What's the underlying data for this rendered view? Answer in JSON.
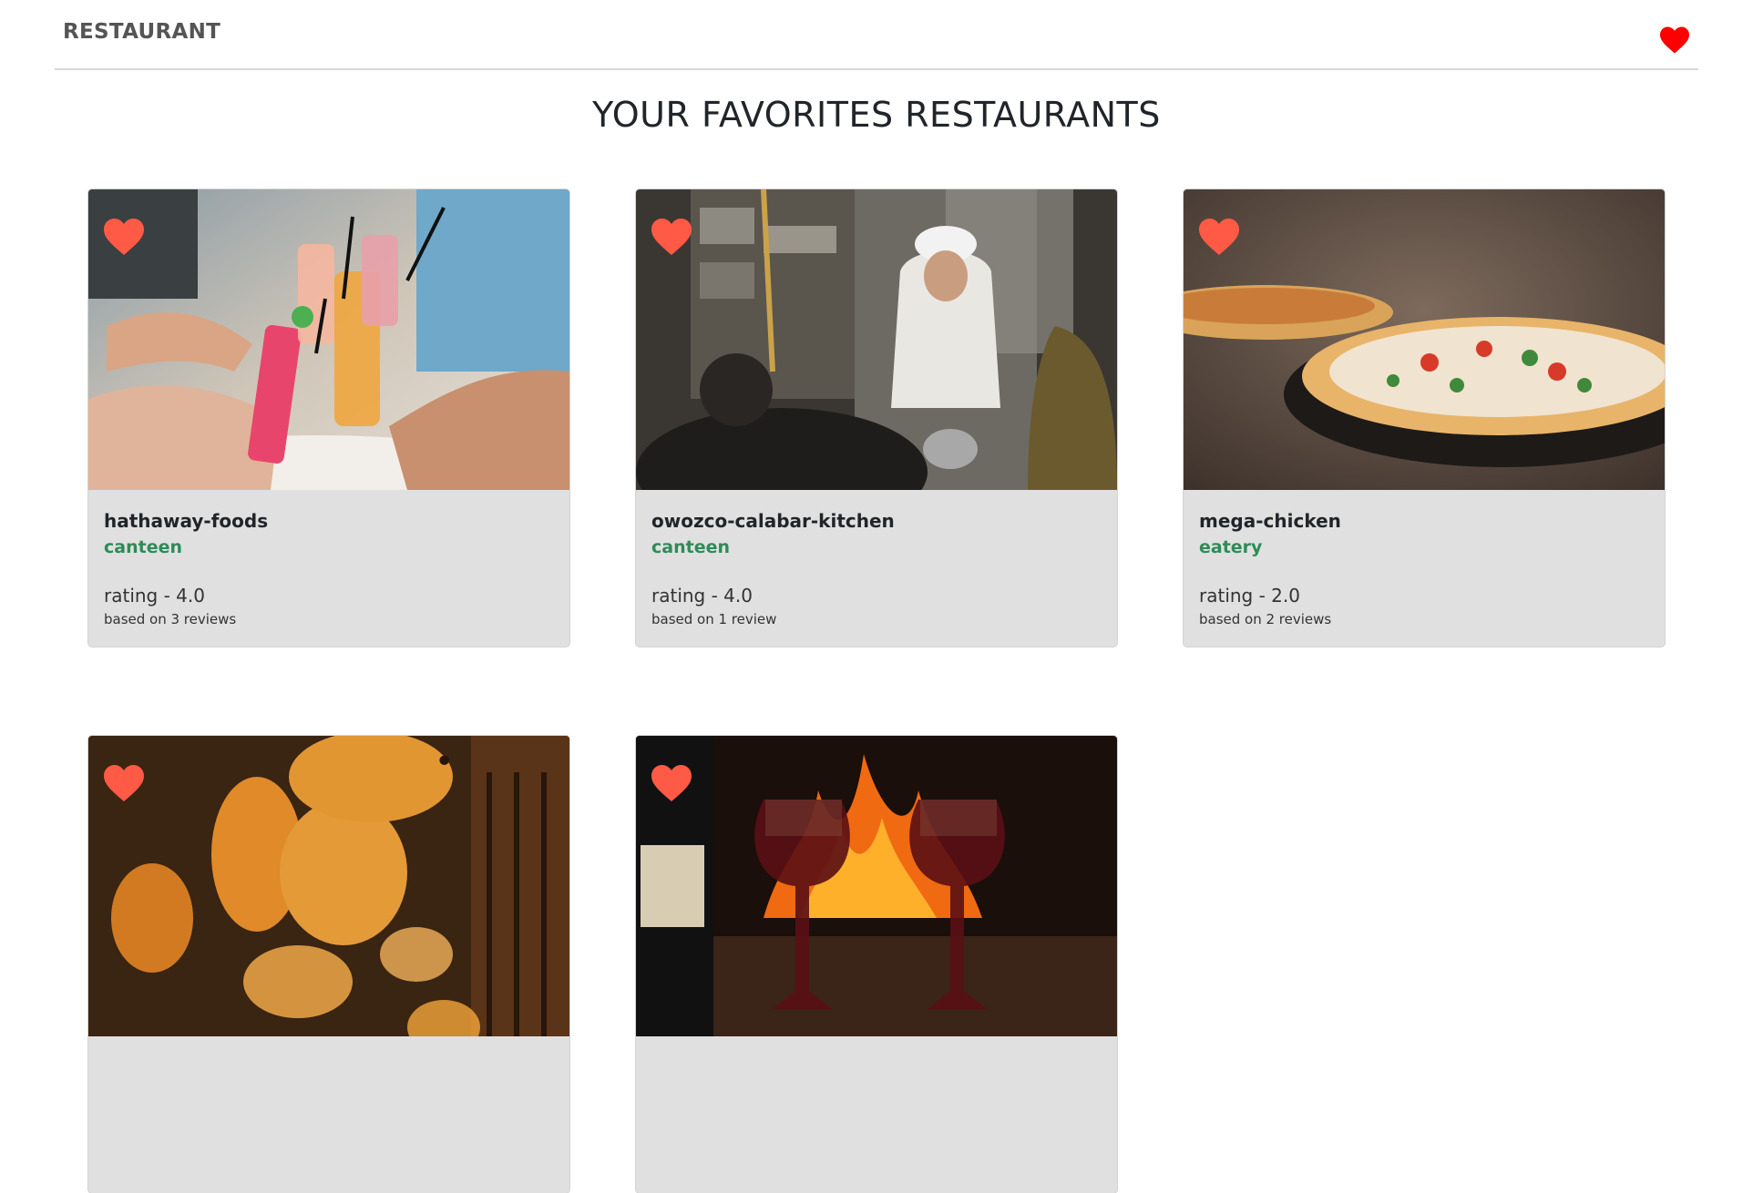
{
  "navbar": {
    "brand": "RESTAURANT",
    "favorites_icon": "heart-icon",
    "heart_color": "#ff0000"
  },
  "page": {
    "title": "YOUR FAVORITES RESTAURANTS"
  },
  "colors": {
    "type_text": "#2e8b57",
    "card_heart": "#ff5a45",
    "card_bg": "#e0e0e0"
  },
  "restaurants": [
    {
      "name": "hathaway-foods",
      "type": "canteen",
      "rating": "rating - 4.0",
      "reviews": "based on 3 reviews",
      "image": "cocktails-toast"
    },
    {
      "name": "owozco-calabar-kitchen",
      "type": "canteen",
      "rating": "rating - 4.0",
      "reviews": "based on 1 review",
      "image": "chef-kitchen"
    },
    {
      "name": "mega-chicken",
      "type": "eatery",
      "rating": "rating - 2.0",
      "reviews": "based on 2 reviews",
      "image": "pizza-oven"
    },
    {
      "name": "",
      "type": "",
      "rating": "",
      "reviews": "",
      "image": "paper-lanterns"
    },
    {
      "name": "",
      "type": "",
      "rating": "",
      "reviews": "",
      "image": "wine-fireplace"
    }
  ]
}
